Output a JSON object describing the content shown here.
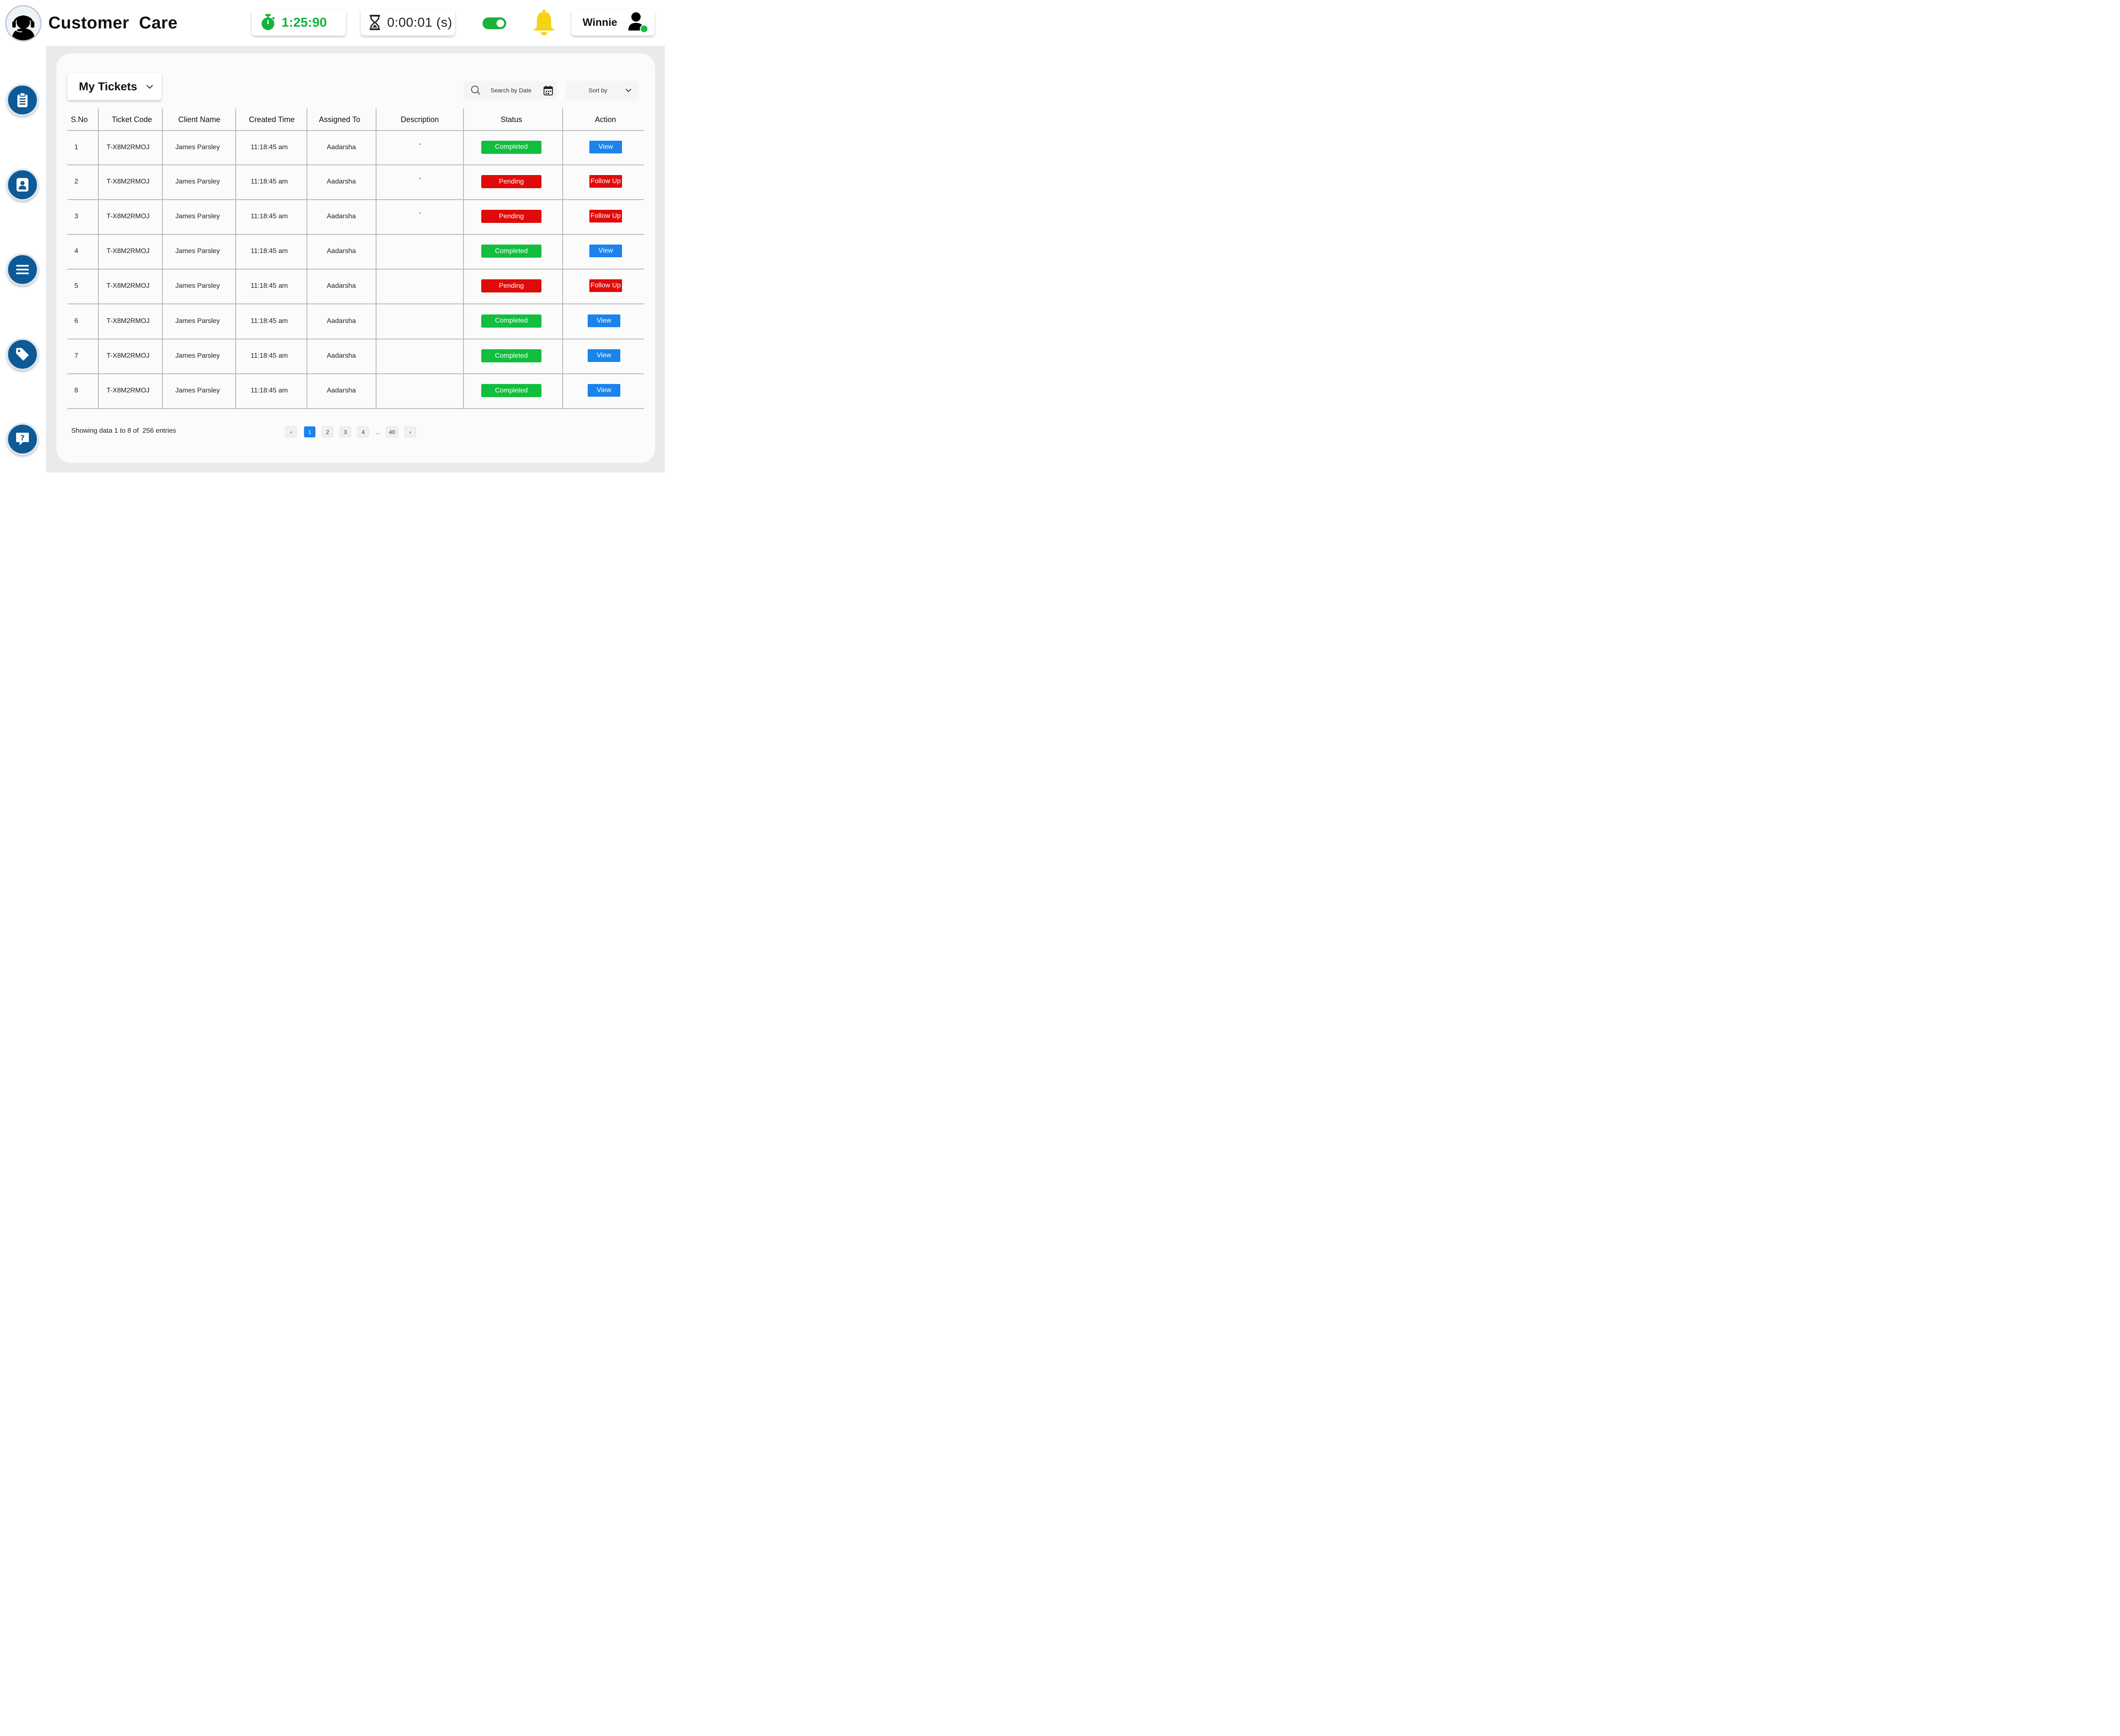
{
  "header": {
    "title": "Customer  Care",
    "timer_value": "1:25:90",
    "session_value": "0:00:01 (s)",
    "status_toggle": "on",
    "user_name": "Winnie",
    "user_status": "online"
  },
  "sidebar": {
    "items": [
      {
        "name": "clipboard-icon"
      },
      {
        "name": "contact-card-icon"
      },
      {
        "name": "menu-icon"
      },
      {
        "name": "tag-icon"
      },
      {
        "name": "help-chat-icon"
      }
    ]
  },
  "main": {
    "view_selector": "My Tickets",
    "search_placeholder": "Search by Date",
    "sort_label": "Sort by"
  },
  "table": {
    "columns": [
      "S.No",
      "Ticket Code",
      "Client Name",
      "Created Time",
      "Assigned To",
      "Description",
      "Status",
      "Action"
    ],
    "rows": [
      {
        "sno": "1",
        "code": "T-X8M2RMOJ",
        "client": "James Parsley",
        "time": "11:18:45 am",
        "assigned": "Aadarsha",
        "desc": "-",
        "status": "Completed",
        "action": "View"
      },
      {
        "sno": "2",
        "code": "T-X8M2RMOJ",
        "client": "James Parsley",
        "time": "11:18:45 am",
        "assigned": "Aadarsha",
        "desc": "-",
        "status": "Pending",
        "action": "Follow Up"
      },
      {
        "sno": "3",
        "code": "T-X8M2RMOJ",
        "client": "James Parsley",
        "time": "11:18:45 am",
        "assigned": "Aadarsha",
        "desc": "-",
        "status": "Pending",
        "action": "Follow Up"
      },
      {
        "sno": "4",
        "code": "T-X8M2RMOJ",
        "client": "James Parsley",
        "time": "11:18:45 am",
        "assigned": "Aadarsha",
        "desc": "",
        "status": "Completed",
        "action": "View"
      },
      {
        "sno": "5",
        "code": "T-X8M2RMOJ",
        "client": "James Parsley",
        "time": "11:18:45 am",
        "assigned": "Aadarsha",
        "desc": "",
        "status": "Pending",
        "action": "Follow Up"
      },
      {
        "sno": "6",
        "code": "T-X8M2RMOJ",
        "client": "James Parsley",
        "time": "11:18:45 am",
        "assigned": "Aadarsha",
        "desc": "",
        "status": "Completed",
        "action": "View"
      },
      {
        "sno": "7",
        "code": "T-X8M2RMOJ",
        "client": "James Parsley",
        "time": "11:18:45 am",
        "assigned": "Aadarsha",
        "desc": "",
        "status": "Completed",
        "action": "View"
      },
      {
        "sno": "8",
        "code": "T-X8M2RMOJ",
        "client": "James Parsley",
        "time": "11:18:45 am",
        "assigned": "Aadarsha",
        "desc": "",
        "status": "Completed",
        "action": "View"
      }
    ]
  },
  "footer": {
    "summary": "Showing data 1 to 8 of  256 entries",
    "pages": [
      "‹",
      "1",
      "2",
      "3",
      "4",
      "...",
      "40",
      "›"
    ],
    "current_page": "1"
  },
  "colors": {
    "brand_blue": "#0d5a97",
    "completed_green": "#12be3d",
    "pending_red": "#e00a0a",
    "action_blue": "#1a83ec",
    "timer_green": "#12b53c",
    "bell_yellow": "#f5d316"
  }
}
